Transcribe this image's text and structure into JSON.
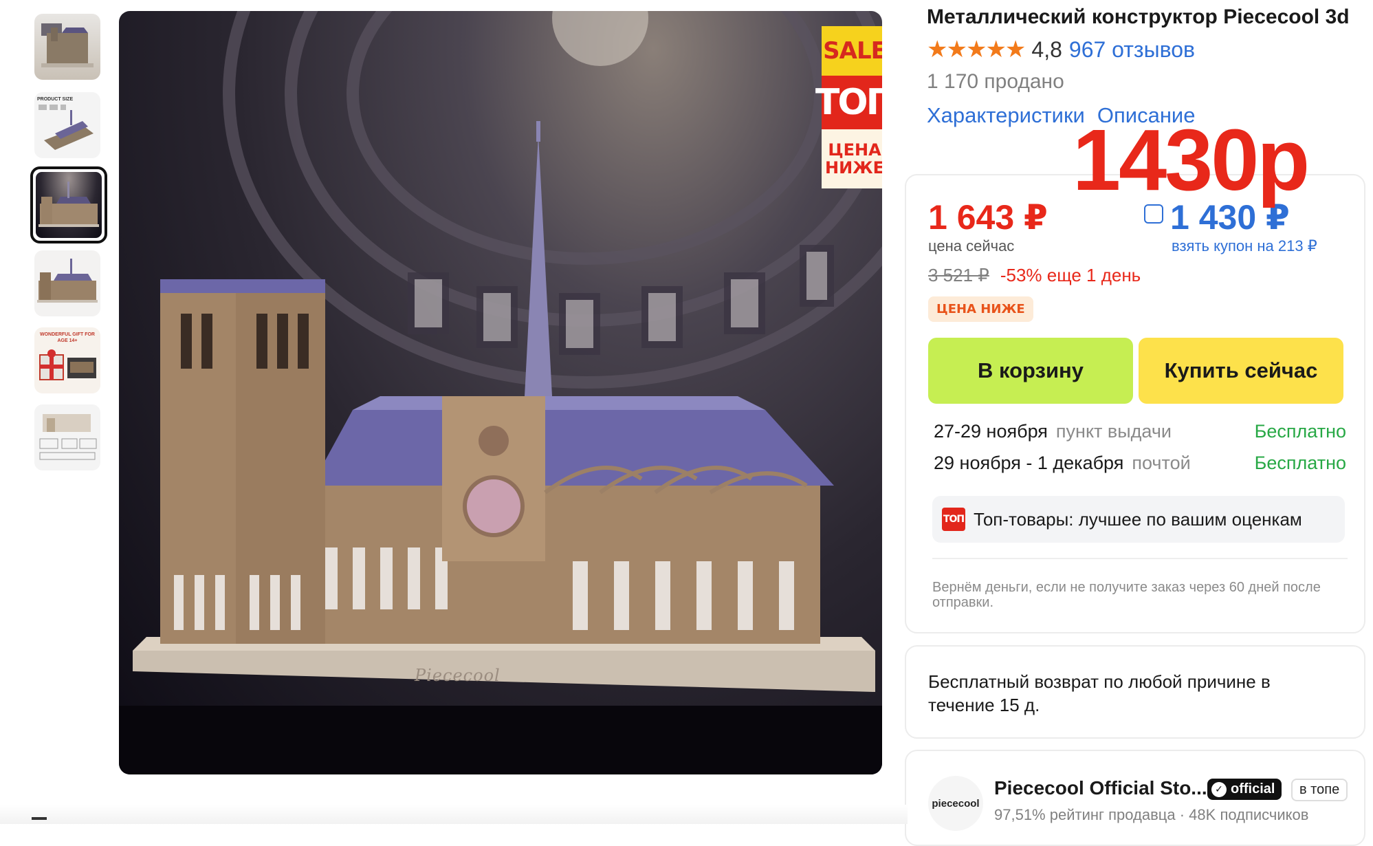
{
  "product": {
    "title": "Металлический конструктор Piececool 3d",
    "rating": "4,8",
    "reviews": "967 отзывов",
    "sold": "1 170 продано",
    "tabs": [
      "Характеристики",
      "Описание"
    ],
    "stars": "★★★★★"
  },
  "overlay": {
    "big_price": "1430р"
  },
  "gallery": {
    "thumb_texts": [
      "",
      "PRODUCT SIZE",
      "",
      "",
      "WONDERFUL GIFT FOR AGE 14+",
      ""
    ],
    "sale_tag": {
      "top": "SALE",
      "mid": "ТОП",
      "bottom_line1": "ЦЕНА",
      "bottom_line2": "НИЖЕ"
    },
    "base_brand": "Piececool"
  },
  "price": {
    "now": "1 643 ₽",
    "now_label": "цена сейчас",
    "coupon_price": "1 430 ₽",
    "coupon_label": "взять купон на 213 ₽",
    "old": "3 521 ₽",
    "discount": "-53% еще 1 день",
    "badge": "ЦЕНА НИЖЕ",
    "cart_label": "В корзину",
    "buy_label": "Купить сейчас"
  },
  "delivery": [
    {
      "date": "27-29 ноября",
      "method": "пункт выдачи",
      "cost": "Бесплатно"
    },
    {
      "date": "29 ноября - 1 декабря",
      "method": "почтой",
      "cost": "Бесплатно"
    }
  ],
  "top_goods": {
    "icon_text": "ТОП",
    "text": "Топ-товары: лучшее по вашим оценкам"
  },
  "refund": "Вернём деньги, если не получите заказ через 60 дней после отправки.",
  "return_policy": "Бесплатный возврат по любой причине в течение 15 д.",
  "store": {
    "logo_text": "piececool",
    "name": "Piececool Official Sto...",
    "official": "official",
    "in_top": "в топе",
    "meta": "97,51% рейтинг продавца · 48K подписчиков"
  },
  "colors": {
    "accent_red": "#e8281a",
    "link_blue": "#2e6fd6",
    "cart_green": "#c6ee52",
    "buy_yellow": "#fde14b",
    "free_green": "#27a845",
    "star_orange": "#f27a1a"
  }
}
